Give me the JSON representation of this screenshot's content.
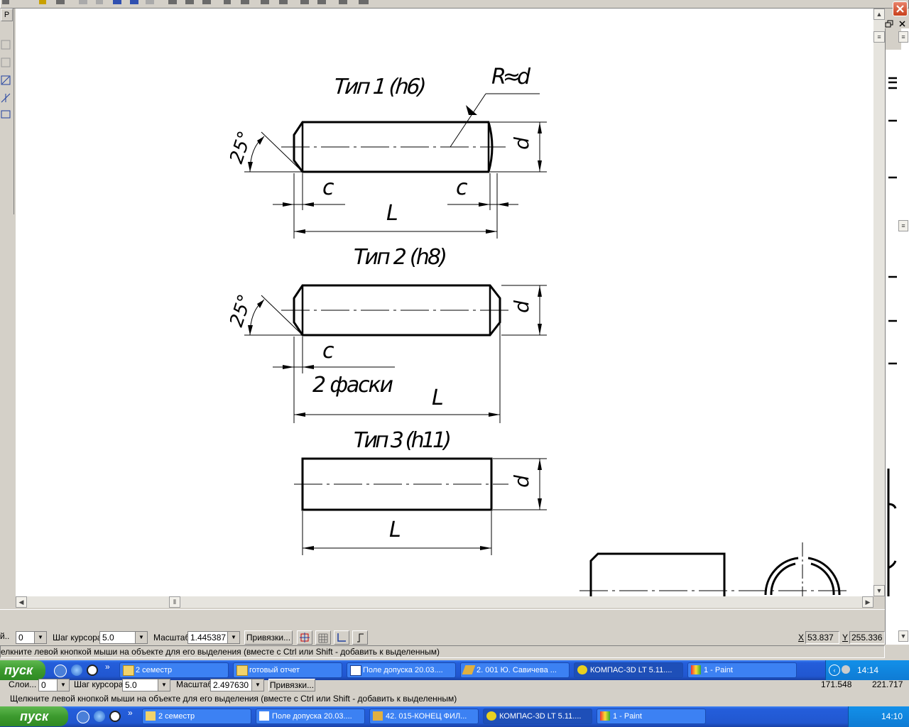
{
  "toolbar": {
    "left_tab": "P"
  },
  "drawing": {
    "type1_title": "Тип 1 (h6)",
    "type2_title": "Тип 2 (h8)",
    "type3_title": "Тип 3 (h11)",
    "radius_label": "R≈d",
    "angle_label": "25°",
    "chamfer_label": "c",
    "length_label": "L",
    "diameter_label": "d",
    "chamfers_note": "2 фаски"
  },
  "status_panel": {
    "layer_label": "й..",
    "layer_value": "0",
    "cursor_step_label": "Шаг курсора",
    "cursor_step_value": "5.0",
    "scale_label": "Масштаб",
    "scale_value": "1.445387",
    "snaps_button": "Привязки...",
    "x_label": "X",
    "x_value": "53.837",
    "y_label": "Y",
    "y_value": "255.336",
    "hint": "елкните левой кнопкой мыши на объекте для его выделения (вместе с Ctrl или Shift - добавить к выделенным)"
  },
  "taskbar": {
    "start_label": "пуск",
    "tasks": [
      {
        "label": "2 семестр",
        "icon": "folder-icon"
      },
      {
        "label": "готовый отчет",
        "icon": "folder-icon"
      },
      {
        "label": "Поле допуска 20.03....",
        "icon": "word-icon"
      },
      {
        "label": "2. 001 Ю. Савичева ...",
        "icon": "pencil-icon"
      },
      {
        "label": "КОМПАС-3D LT 5.11....",
        "icon": "kompas-icon"
      },
      {
        "label": "1 - Paint",
        "icon": "paint-icon"
      }
    ],
    "clock": "14:14"
  },
  "ghost": {
    "layers_label": "Слои...",
    "layer_value": "0",
    "cursor_step_label": "Шаг курсора",
    "cursor_step_value": "5.0",
    "scale_label": "Масштаб",
    "scale_value": "2.497630",
    "snaps_button": "Привязки...",
    "x_value": "171.548",
    "y_value": "221.717",
    "hint": "Щелкните левой кнопкой мыши на объекте для его выделения (вместе с Ctrl или Shift - добавить к выделенным)",
    "start_label": "пуск",
    "tasks": [
      "2 семестр",
      "Поле допуска 20.03....",
      "42. 015-КОНЕЦ ФИЛ...",
      "КОМПАС-3D LT 5.11....",
      "1 - Paint"
    ],
    "clock": "14:10"
  }
}
